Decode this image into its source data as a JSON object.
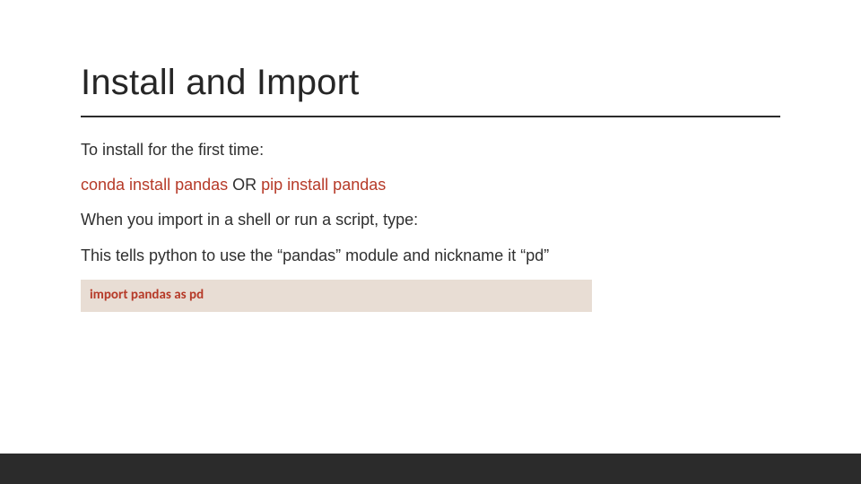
{
  "title": "Install and Import",
  "lines": {
    "intro": "To install for the first time:",
    "install_conda": "conda install pandas",
    "install_sep": " OR ",
    "install_pip": "pip install pandas",
    "when_import": "When you import in a shell or run a script, type:",
    "explain": "This tells python to use the “pandas” module and nickname it “pd”"
  },
  "code": "import pandas as pd"
}
